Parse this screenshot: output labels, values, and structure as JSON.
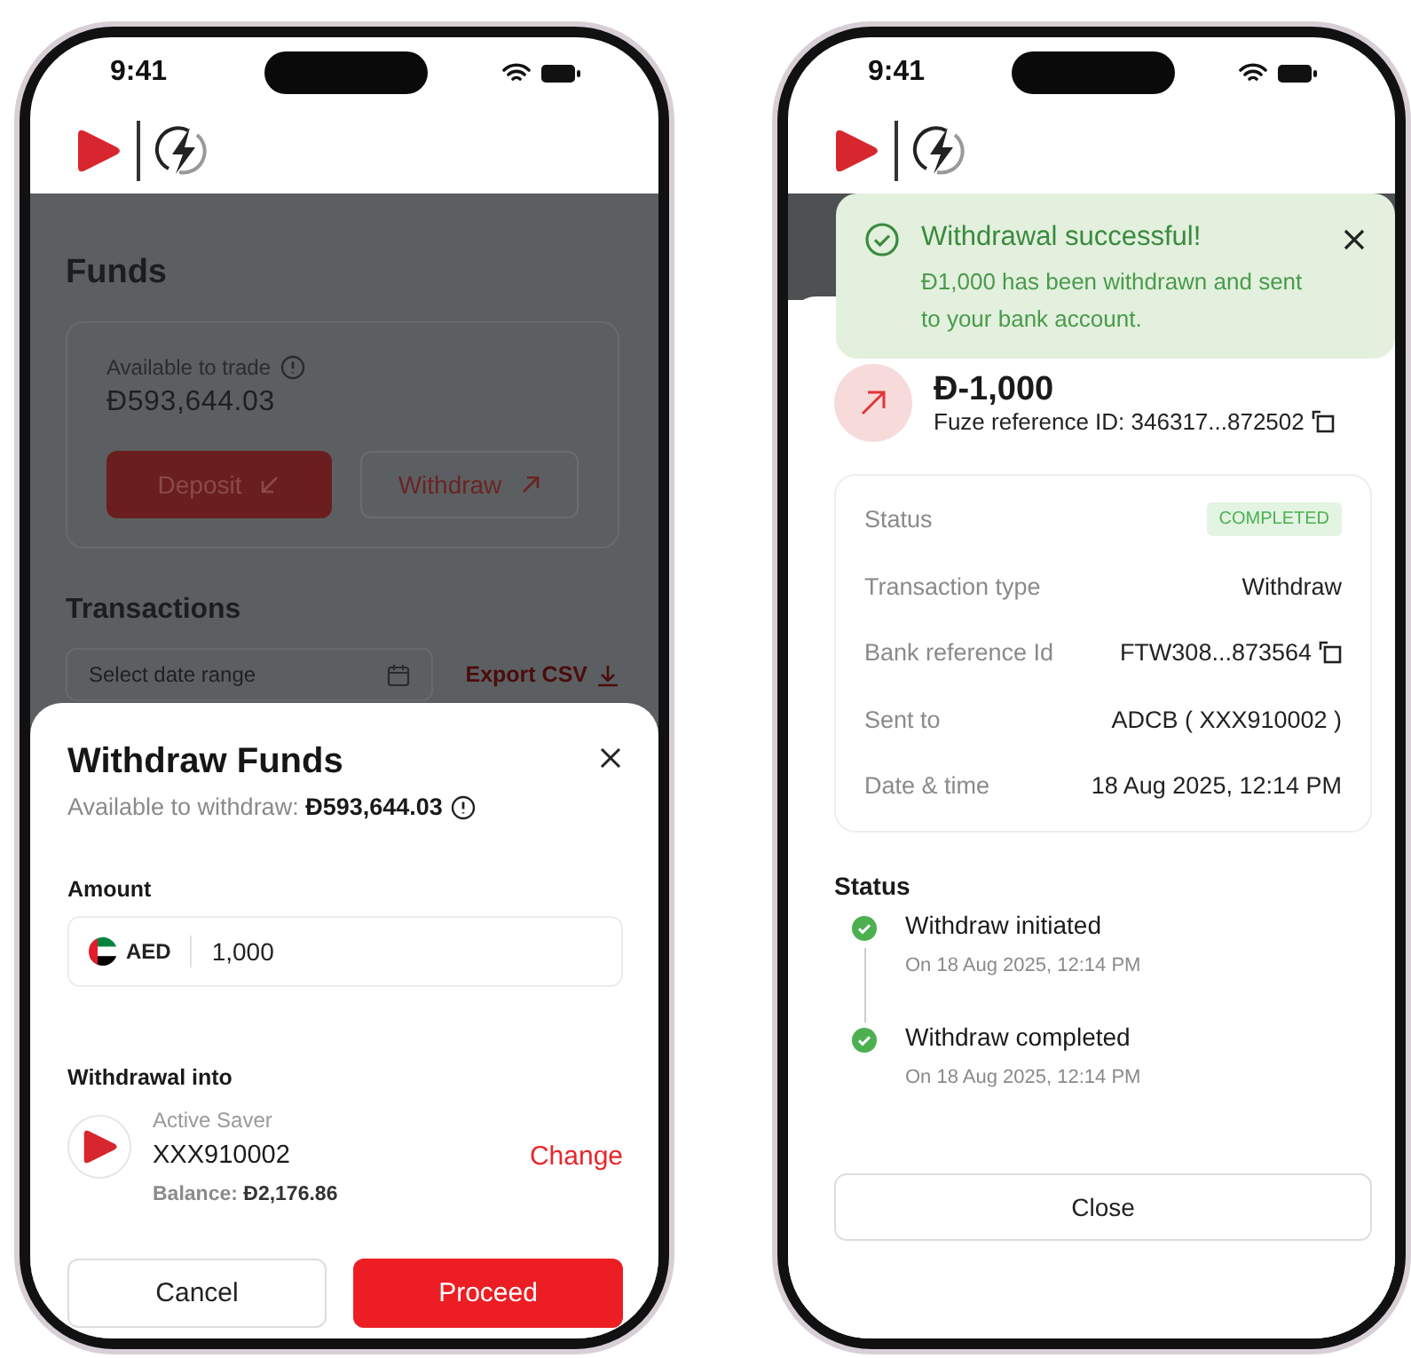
{
  "withdraw_screen": {
    "status_bar": {
      "time": "9:41"
    },
    "funds": {
      "title": "Funds",
      "available_label": "Available to trade",
      "available_amount": "Đ593,644.03",
      "deposit_button": "Deposit",
      "withdraw_button": "Withdraw",
      "transactions_title": "Transactions",
      "date_placeholder": "Select date range",
      "export_link": "Export CSV"
    },
    "sheet": {
      "title": "Withdraw Funds",
      "available_text": "Available to withdraw: **Đ593,644.03**",
      "amount_label": "Amount",
      "currency": "AED",
      "amount_value": "1,000",
      "withdrawal_into_label": "Withdrawal into",
      "account_type": "Active Saver",
      "account_number": "XXX910002",
      "balance_text": "Balance: **Đ2,176.86**",
      "change_link": "Change",
      "cancel_button": "Cancel",
      "proceed_button": "Proceed"
    }
  },
  "success_screen": {
    "status_bar": {
      "time": "9:41"
    },
    "toast": {
      "title": "Withdrawal successful!",
      "message": "Đ1,000 has been withdrawn and sent to your bank account."
    },
    "amount": "Đ-1,000",
    "reference": "Fuze reference ID: 346317...872502",
    "details": [
      {
        "label": "Status",
        "value": "COMPLETED",
        "kind": "badge"
      },
      {
        "label": "Transaction type",
        "value": "Withdraw",
        "kind": "text"
      },
      {
        "label": "Bank reference Id",
        "value": "FTW308...873564",
        "kind": "copy"
      },
      {
        "label": "Sent to",
        "value": "ADCB ( XXX910002 )",
        "kind": "text"
      },
      {
        "label": "Date & time",
        "value": "18 Aug 2025, 12:14 PM",
        "kind": "text"
      }
    ],
    "status_title": "Status",
    "timeline": [
      {
        "title": "Withdraw initiated",
        "time": "On 18 Aug 2025, 12:14 PM",
        "done": true
      },
      {
        "title": "Withdraw completed",
        "time": "On 18 Aug 2025, 12:14 PM",
        "done": true
      }
    ],
    "close_button": "Close"
  }
}
